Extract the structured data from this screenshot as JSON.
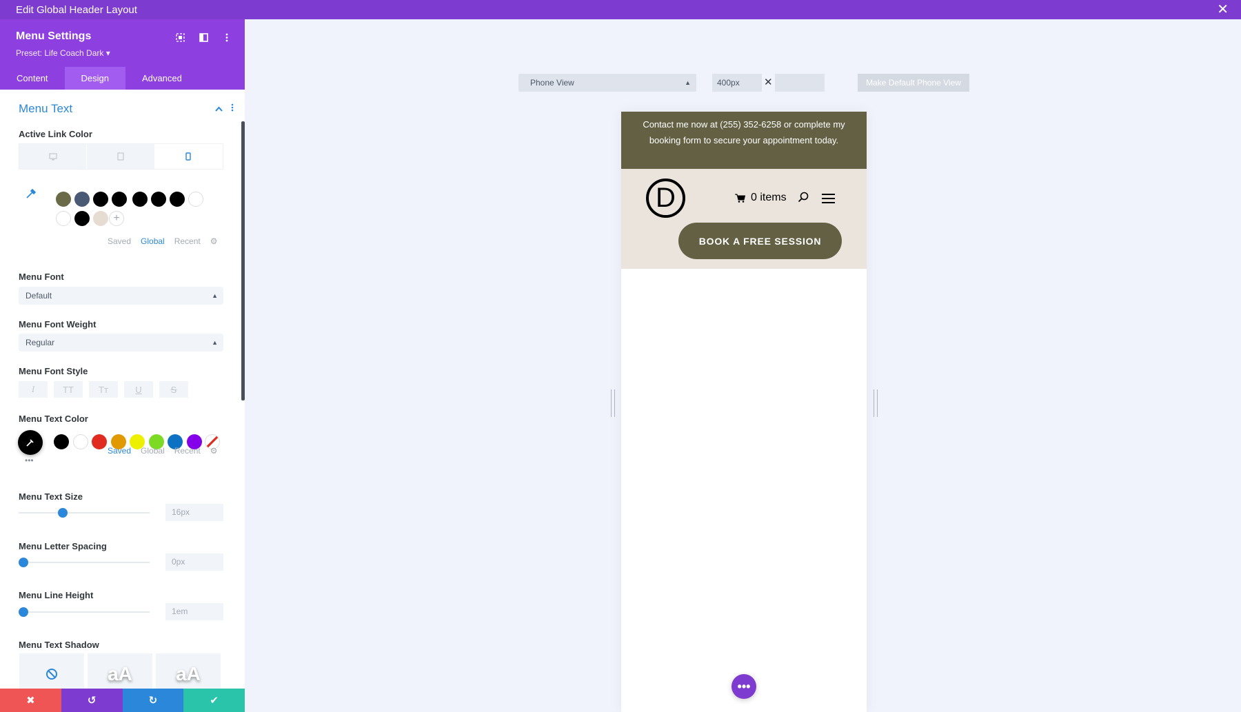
{
  "window": {
    "title": "Edit Global Header Layout",
    "close_glyph": "✕"
  },
  "panel": {
    "title": "Menu Settings",
    "preset": "Preset: Life Coach Dark ▾",
    "tabs": [
      {
        "label": "Content"
      },
      {
        "label": "Design",
        "active": true
      },
      {
        "label": "Advanced"
      }
    ],
    "section_title": "Menu Text",
    "active_link_color": {
      "label": "Active Link Color",
      "swatches": [
        "#6b6a48",
        "#4a5a75",
        "#000000",
        "#000000",
        "#000000",
        "#000000",
        "#000000",
        "#ffffff",
        "#ffffff",
        "#000000",
        "#e6dcd2"
      ],
      "tabs": {
        "saved": "Saved",
        "global": "Global",
        "recent": "Recent",
        "active": "global"
      }
    },
    "menu_font": {
      "label": "Menu Font",
      "value": "Default"
    },
    "menu_font_weight": {
      "label": "Menu Font Weight",
      "value": "Regular"
    },
    "menu_font_style": {
      "label": "Menu Font Style",
      "buttons": [
        "I",
        "TT",
        "Tт",
        "U",
        "S"
      ]
    },
    "menu_text_color": {
      "label": "Menu Text Color",
      "current": "#000000",
      "swatches": [
        "#000000",
        "#ffffff",
        "#e02b20",
        "#e09900",
        "#edf000",
        "#7cda24",
        "#0c71c3",
        "#8300e9"
      ],
      "tabs": {
        "saved": "Saved",
        "global": "Global",
        "recent": "Recent",
        "active": "saved"
      }
    },
    "menu_text_size": {
      "label": "Menu Text Size",
      "value": "16px",
      "level": 0.3
    },
    "menu_letter_spacing": {
      "label": "Menu Letter Spacing",
      "value": "0px",
      "level": 0
    },
    "menu_line_height": {
      "label": "Menu Line Height",
      "value": "1em",
      "level": 0
    },
    "menu_text_shadow": {
      "label": "Menu Text Shadow",
      "preview_text": "aA"
    },
    "bottom_bar": {
      "colors": [
        "#ef5555",
        "#7e3bd0",
        "#2b87da",
        "#29c4a9"
      ]
    }
  },
  "canvas": {
    "view_select": "Phone View",
    "width_value": "400px",
    "height_value": "",
    "make_default_label": "Make Default Phone View"
  },
  "preview": {
    "notice": "Contact me now at (255) 352-6258 or complete my booking form to secure your appointment today.",
    "logo_letter": "D",
    "cart_label": "0 items",
    "cta_label": "BOOK A FREE SESSION",
    "colors": {
      "notice_bg": "#636044",
      "header_bg": "#ebe4dd",
      "cta_bg": "#636044"
    }
  },
  "fab_glyph": "•••"
}
